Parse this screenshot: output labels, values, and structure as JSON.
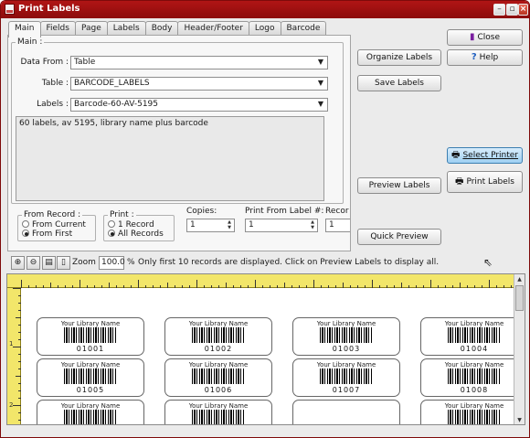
{
  "window": {
    "title": "Print Labels"
  },
  "tabs": [
    "Main",
    "Fields",
    "Page",
    "Labels",
    "Body",
    "Header/Footer",
    "Logo",
    "Barcode"
  ],
  "main": {
    "group_label": "Main :",
    "data_from_label": "Data From :",
    "data_from_value": "Table",
    "table_label": "Table :",
    "table_value": "BARCODE_LABELS",
    "labels_label": "Labels :",
    "labels_value": "Barcode-60-AV-5195",
    "description": "60 labels, av 5195, library name plus barcode"
  },
  "from_record": {
    "label": "From Record :",
    "options": [
      "From Current",
      "From First"
    ],
    "selected": "From First"
  },
  "print": {
    "label": "Print :",
    "options": [
      "1 Record",
      "All Records"
    ],
    "selected": "All Records"
  },
  "copies": {
    "label": "Copies:",
    "value": "1"
  },
  "print_from_label": {
    "label": "Print From Label #:",
    "value": "1"
  },
  "records_partial": {
    "label": "Recor",
    "value": "1"
  },
  "buttons": {
    "close": "Close",
    "help": "Help",
    "organize": "Organize Labels",
    "save": "Save Labels",
    "select_printer": "Select Printer",
    "preview": "Preview Labels",
    "print": "Print Labels",
    "quick_preview": "Quick Preview"
  },
  "toolbar": {
    "zoom_label": "Zoom",
    "zoom_value": "100.0",
    "zoom_unit": "%",
    "message": "Only first 10 records are displayed. Click on Preview Labels to display all."
  },
  "ruler": {
    "vertical_marks": [
      "1",
      "2"
    ]
  },
  "preview_labels": [
    {
      "library": "Your Library Name",
      "code": "01001"
    },
    {
      "library": "Your Library Name",
      "code": "01002"
    },
    {
      "library": "Your Library Name",
      "code": "01003"
    },
    {
      "library": "Your Library Name",
      "code": "01004"
    },
    {
      "library": "Your Library Name",
      "code": "01005"
    },
    {
      "library": "Your Library Name",
      "code": "01006"
    },
    {
      "library": "Your Library Name",
      "code": "01007"
    },
    {
      "library": "Your Library Name",
      "code": "01008"
    },
    {
      "library": "Your Library Name",
      "code": ""
    },
    {
      "library": "Your Library Name",
      "code": ""
    },
    {
      "library": "",
      "code": ""
    },
    {
      "library": "Your Library Name",
      "code": ""
    }
  ],
  "colors": {
    "titlebar": "#9e1010",
    "ruler": "#f2e66a",
    "highlight_button": "#a9d6f5"
  }
}
